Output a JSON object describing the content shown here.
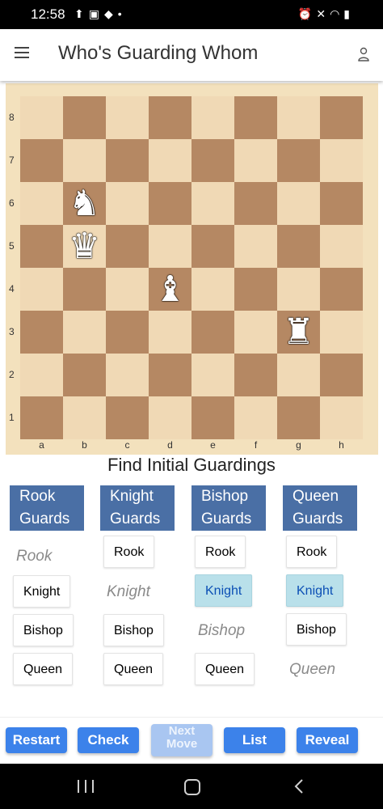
{
  "status_bar": {
    "time": "12:58",
    "left_icons": [
      "upload-icon",
      "image-icon",
      "bag-icon",
      "dot-icon"
    ],
    "right_icons": [
      "alarm-icon",
      "mute-icon",
      "wifi-icon",
      "battery-icon"
    ]
  },
  "app_bar": {
    "title": "Who's Guarding Whom",
    "menu_icon": "menu-icon",
    "account_icon": "user-icon"
  },
  "board": {
    "ranks": [
      "8",
      "7",
      "6",
      "5",
      "4",
      "3",
      "2",
      "1"
    ],
    "files": [
      "a",
      "b",
      "c",
      "d",
      "e",
      "f",
      "g",
      "h"
    ],
    "light_square_color": "#f0d9b5",
    "dark_square_color": "#b58863",
    "pieces": [
      {
        "square": "b6",
        "piece": "knight",
        "color": "white"
      },
      {
        "square": "b5",
        "piece": "queen",
        "color": "white"
      },
      {
        "square": "d4",
        "piece": "bishop",
        "color": "white"
      },
      {
        "square": "g3",
        "piece": "rook",
        "color": "white"
      }
    ]
  },
  "prompt": "Find Initial Guardings",
  "columns": [
    {
      "header_line1": "Rook",
      "header_line2": "Guards",
      "options": [
        {
          "label": "Rook",
          "state": "disabled"
        },
        {
          "label": "Knight",
          "state": "normal"
        },
        {
          "label": "Bishop",
          "state": "normal"
        },
        {
          "label": "Queen",
          "state": "normal"
        }
      ]
    },
    {
      "header_line1": "Knight",
      "header_line2": "Guards",
      "options": [
        {
          "label": "Rook",
          "state": "normal"
        },
        {
          "label": "Knight",
          "state": "disabled"
        },
        {
          "label": "Bishop",
          "state": "normal"
        },
        {
          "label": "Queen",
          "state": "normal"
        }
      ]
    },
    {
      "header_line1": "Bishop",
      "header_line2": "Guards",
      "options": [
        {
          "label": "Rook",
          "state": "normal"
        },
        {
          "label": "Knight",
          "state": "selected"
        },
        {
          "label": "Bishop",
          "state": "disabled"
        },
        {
          "label": "Queen",
          "state": "normal"
        }
      ]
    },
    {
      "header_line1": "Queen",
      "header_line2": "Guards",
      "options": [
        {
          "label": "Rook",
          "state": "normal"
        },
        {
          "label": "Knight",
          "state": "selected"
        },
        {
          "label": "Bishop",
          "state": "normal"
        },
        {
          "label": "Queen",
          "state": "disabled"
        }
      ]
    }
  ],
  "bottom_buttons": {
    "restart": "Restart",
    "check": "Check",
    "next_move_line1": "Next",
    "next_move_line2": "Move",
    "list": "List",
    "reveal": "Reveal"
  },
  "colors": {
    "header_blue": "#4a6fa5",
    "button_blue": "#3c82ea",
    "selected_bg": "#b9e0ea"
  }
}
